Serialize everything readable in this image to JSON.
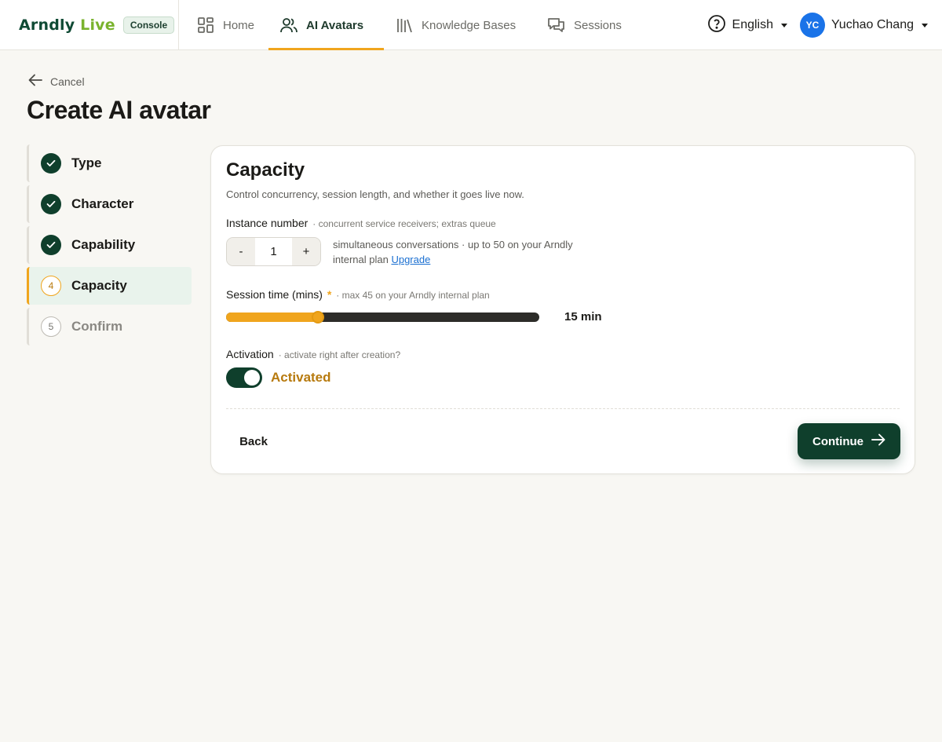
{
  "brand": {
    "logo_main": "Arndly",
    "logo_live": "Live",
    "badge": "Console"
  },
  "nav": {
    "items": [
      {
        "label": "Home",
        "icon": "grid-icon"
      },
      {
        "label": "AI Avatars",
        "icon": "users-icon",
        "active": true
      },
      {
        "label": "Knowledge Bases",
        "icon": "books-icon"
      },
      {
        "label": "Sessions",
        "icon": "chat-bubbles-icon"
      }
    ]
  },
  "header": {
    "language": "English",
    "user_initials": "YC",
    "user_name": "Yuchao Chang"
  },
  "page": {
    "cancel_label": "Cancel",
    "title": "Create AI avatar"
  },
  "steps": [
    {
      "label": "Type",
      "state": "done"
    },
    {
      "label": "Character",
      "state": "done"
    },
    {
      "label": "Capability",
      "state": "done"
    },
    {
      "label": "Capacity",
      "state": "current",
      "number": "4"
    },
    {
      "label": "Confirm",
      "state": "todo",
      "number": "5"
    }
  ],
  "card": {
    "title": "Capacity",
    "subtitle": "Control concurrency, session length, and whether it goes live now.",
    "instance": {
      "label": "Instance number",
      "hint": "· concurrent service receivers; extras queue",
      "decrement": "-",
      "value": "1",
      "increment": "+",
      "note": "simultaneous conversations · up to 50 on your Arndly internal plan",
      "upgrade": "Upgrade"
    },
    "session": {
      "label": "Session time (mins)",
      "required": "*",
      "hint": "· max 45 on your Arndly internal plan",
      "value_text": "15 min",
      "min": 0,
      "max": 51,
      "value": 15
    },
    "activation": {
      "label": "Activation",
      "hint": "· activate right after creation?",
      "state_label": "Activated",
      "on": true
    },
    "back_label": "Back",
    "continue_label": "Continue"
  },
  "colors": {
    "accent": "#f0a51d",
    "primary": "#0f3f2c",
    "link": "#1a6fd1",
    "avatar": "#1a73e8"
  }
}
